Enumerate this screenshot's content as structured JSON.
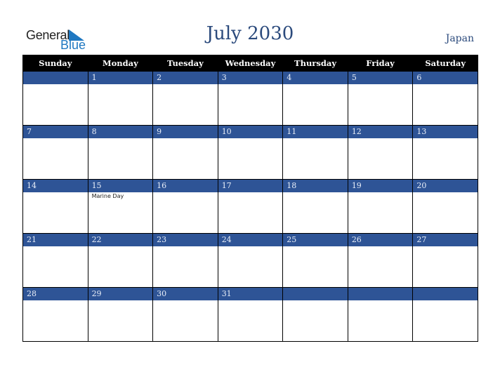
{
  "logo": {
    "text_general": "General",
    "text_blue": "Blue",
    "accent_color": "#1f78c1"
  },
  "header": {
    "title": "July 2030",
    "country": "Japan"
  },
  "weekdays": [
    "Sunday",
    "Monday",
    "Tuesday",
    "Wednesday",
    "Thursday",
    "Friday",
    "Saturday"
  ],
  "weeks": [
    {
      "days": [
        "",
        "1",
        "2",
        "3",
        "4",
        "5",
        "6"
      ],
      "holidays": [
        "",
        "",
        "",
        "",
        "",
        "",
        ""
      ]
    },
    {
      "days": [
        "7",
        "8",
        "9",
        "10",
        "11",
        "12",
        "13"
      ],
      "holidays": [
        "",
        "",
        "",
        "",
        "",
        "",
        ""
      ]
    },
    {
      "days": [
        "14",
        "15",
        "16",
        "17",
        "18",
        "19",
        "20"
      ],
      "holidays": [
        "",
        "Marine Day",
        "",
        "",
        "",
        "",
        ""
      ]
    },
    {
      "days": [
        "21",
        "22",
        "23",
        "24",
        "25",
        "26",
        "27"
      ],
      "holidays": [
        "",
        "",
        "",
        "",
        "",
        "",
        ""
      ]
    },
    {
      "days": [
        "28",
        "29",
        "30",
        "31",
        "",
        "",
        ""
      ],
      "holidays": [
        "",
        "",
        "",
        "",
        "",
        "",
        ""
      ]
    }
  ],
  "colors": {
    "band": "#2e5496",
    "header_bg": "#000000",
    "title": "#2b4a7c"
  }
}
